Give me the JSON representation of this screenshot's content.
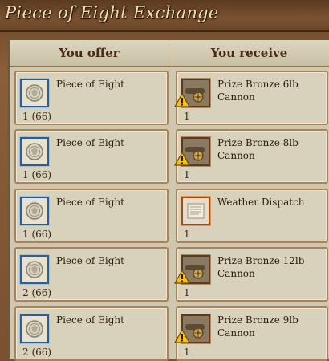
{
  "window": {
    "title": "Piece of Eight Exchange"
  },
  "columns": {
    "offer": "You offer",
    "receive": "You receive"
  },
  "rows": [
    {
      "offer": {
        "name": "Piece of Eight",
        "count": "1 (66)",
        "icon": "piece-of-eight-icon"
      },
      "receive": {
        "name": "Prize Bronze 6lb Cannon",
        "count": "1",
        "icon": "cannon-icon",
        "warning": true
      }
    },
    {
      "offer": {
        "name": "Piece of Eight",
        "count": "1 (66)",
        "icon": "piece-of-eight-icon"
      },
      "receive": {
        "name": "Prize Bronze 8lb Cannon",
        "count": "1",
        "icon": "cannon-icon",
        "warning": true
      }
    },
    {
      "offer": {
        "name": "Piece of Eight",
        "count": "1 (66)",
        "icon": "piece-of-eight-icon"
      },
      "receive": {
        "name": "Weather Dispatch",
        "count": "1",
        "icon": "dispatch-scroll-icon",
        "warning": false
      }
    },
    {
      "offer": {
        "name": "Piece of Eight",
        "count": "2 (66)",
        "icon": "piece-of-eight-icon"
      },
      "receive": {
        "name": "Prize Bronze 12lb Cannon",
        "count": "1",
        "icon": "cannon-icon",
        "warning": true
      }
    },
    {
      "offer": {
        "name": "Piece of Eight",
        "count": "2 (66)",
        "icon": "piece-of-eight-icon"
      },
      "receive": {
        "name": "Prize Bronze 9lb Cannon",
        "count": "1",
        "icon": "cannon-icon",
        "warning": true
      }
    }
  ]
}
